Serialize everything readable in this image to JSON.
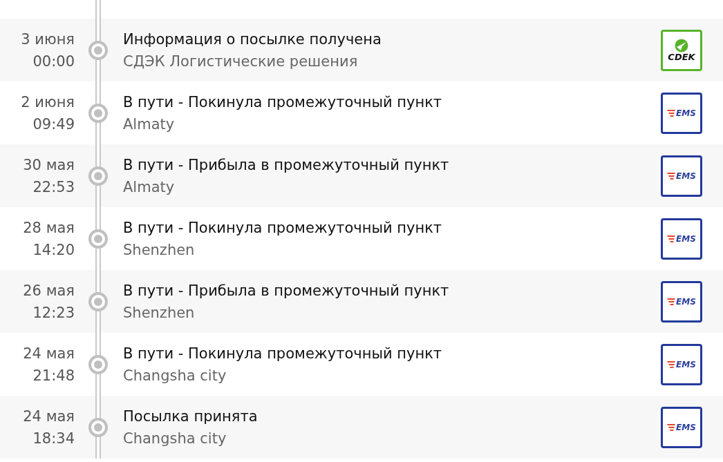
{
  "events": [
    {
      "date": "3 июня",
      "time": "00:00",
      "status": "Информация о посылке получена",
      "place": "СДЭК Логистические решения",
      "carrier": {
        "kind": "cdek",
        "logo_text": "CDEK"
      }
    },
    {
      "date": "2 июня",
      "time": "09:49",
      "status": "В пути - Покинула промежуточный пункт",
      "place": "Almaty",
      "carrier": {
        "kind": "ems",
        "logo_text": "EMS"
      }
    },
    {
      "date": "30 мая",
      "time": "22:53",
      "status": "В пути - Прибыла в промежуточный пункт",
      "place": "Almaty",
      "carrier": {
        "kind": "ems",
        "logo_text": "EMS"
      }
    },
    {
      "date": "28 мая",
      "time": "14:20",
      "status": "В пути - Покинула промежуточный пункт",
      "place": "Shenzhen",
      "carrier": {
        "kind": "ems",
        "logo_text": "EMS"
      }
    },
    {
      "date": "26 мая",
      "time": "12:23",
      "status": "В пути - Прибыла в промежуточный пункт",
      "place": "Shenzhen",
      "carrier": {
        "kind": "ems",
        "logo_text": "EMS"
      }
    },
    {
      "date": "24 мая",
      "time": "21:48",
      "status": "В пути - Покинула промежуточный пункт",
      "place": "Changsha city",
      "carrier": {
        "kind": "ems",
        "logo_text": "EMS"
      }
    },
    {
      "date": "24 мая",
      "time": "18:34",
      "status": "Посылка принята",
      "place": "Changsha city",
      "carrier": {
        "kind": "ems",
        "logo_text": "EMS"
      }
    }
  ]
}
